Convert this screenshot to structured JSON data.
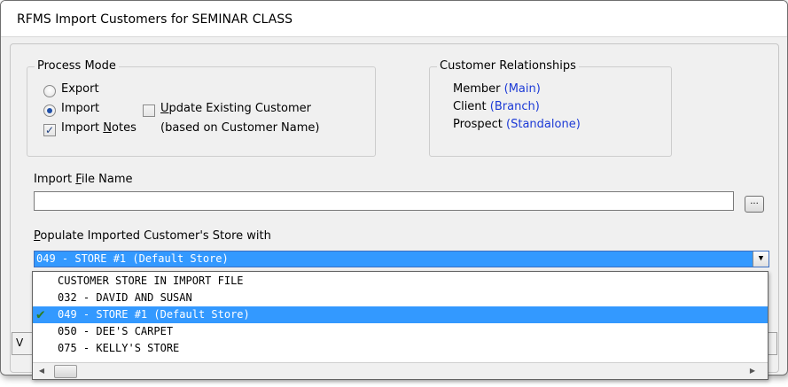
{
  "window": {
    "title": "RFMS Import Customers for SEMINAR CLASS"
  },
  "process_mode": {
    "legend": "Process Mode",
    "export_label": "Export",
    "import_label": "Import",
    "selected": "Import",
    "update_existing_u": "U",
    "update_existing_rest": "pdate Existing Customer",
    "update_existing_checked": false,
    "import_notes_label": "Import Notes",
    "import_notes_u": "N",
    "import_notes_pre": "Import ",
    "import_notes_post": "otes",
    "import_notes_checked": true,
    "based_on": "(based on Customer Name)"
  },
  "relationships": {
    "legend": "Customer Relationships",
    "items": [
      {
        "label": "Member",
        "value": "(Main)"
      },
      {
        "label": "Client",
        "value": "(Branch)"
      },
      {
        "label": "Prospect",
        "value": "(Standalone)"
      }
    ]
  },
  "import_file": {
    "label_pre": "Import ",
    "label_u": "F",
    "label_post": "ile Name",
    "value": "",
    "browse_label": "..."
  },
  "store": {
    "label_u": "P",
    "label_post": "opulate Imported Customer's Store with",
    "selected": "049 - STORE #1 (Default Store)",
    "options": [
      "CUSTOMER STORE IN IMPORT FILE",
      "032 - DAVID AND SUSAN",
      "049 - STORE #1 (Default Store)",
      "050 - DEE'S CARPET",
      "075 - KELLY'S STORE"
    ]
  },
  "behind_text": "V",
  "colors": {
    "selection": "#3399ff",
    "link_blue": "#1c3ad6",
    "check_green": "#2e7d1e"
  }
}
